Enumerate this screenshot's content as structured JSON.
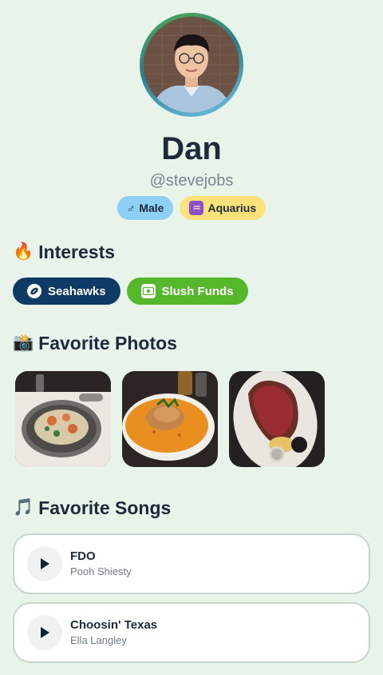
{
  "profile": {
    "name": "Dan",
    "handle": "@stevejobs",
    "badges": [
      {
        "icon": "male-sign-icon",
        "label": "Male",
        "color": "#8dcff5"
      },
      {
        "icon": "aquarius-icon",
        "label": "Aquarius",
        "color": "#fde27a"
      }
    ]
  },
  "interests": {
    "title": "Interests",
    "emoji": "🔥",
    "items": [
      {
        "label": "Seahawks",
        "icon": "football-icon",
        "color": "#0d3b66"
      },
      {
        "label": "Slush Funds",
        "icon": "money-icon",
        "color": "#55b82a"
      }
    ]
  },
  "photos": {
    "title": "Favorite Photos",
    "emoji": "📸",
    "items": [
      {
        "icon": "pasta-dish-photo"
      },
      {
        "icon": "fish-dish-photo"
      },
      {
        "icon": "prime-rib-photo"
      }
    ]
  },
  "songs": {
    "title": "Favorite Songs",
    "emoji": "🎵",
    "items": [
      {
        "title": "FDO",
        "artist": "Pooh Shiesty"
      },
      {
        "title": "Choosin' Texas",
        "artist": "Ella Langley"
      }
    ]
  }
}
